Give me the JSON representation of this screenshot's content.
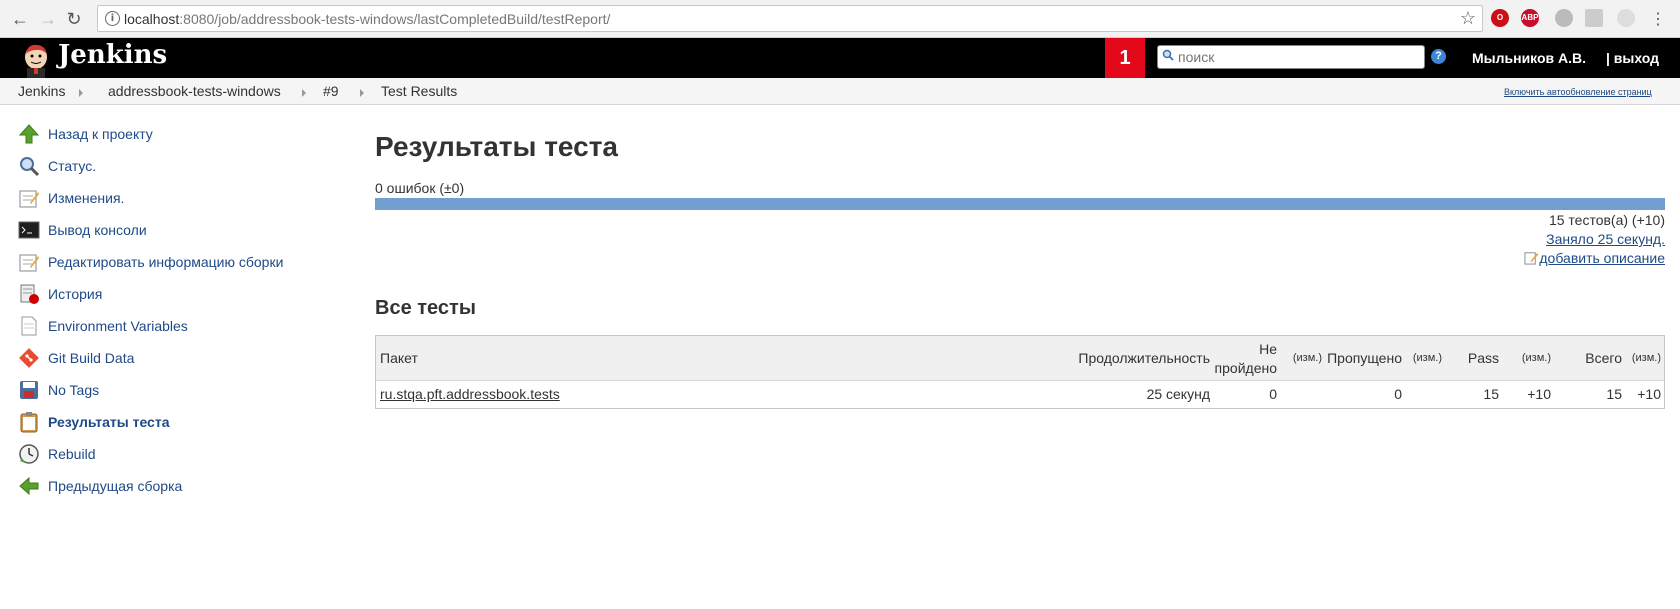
{
  "browser": {
    "url_host": "localhost",
    "url_rest": ":8080/job/addressbook-tests-windows/lastCompletedBuild/testReport/",
    "ext_abp": "ABP"
  },
  "header": {
    "brand": "Jenkins",
    "notification_count": "1",
    "search_placeholder": "поиск",
    "help": "?",
    "user": "Мыльников А.В.",
    "logout": "| выход"
  },
  "breadcrumb": {
    "items": [
      "Jenkins",
      "addressbook-tests-windows",
      "#9",
      "Test Results"
    ],
    "autorefresh": "Включить автообновление страниц"
  },
  "sidebar": {
    "items": [
      {
        "label": "Назад к проекту",
        "icon": "up-arrow-icon"
      },
      {
        "label": "Статус.",
        "icon": "magnifier-icon"
      },
      {
        "label": "Изменения.",
        "icon": "notepad-icon"
      },
      {
        "label": "Вывод консоли",
        "icon": "terminal-icon"
      },
      {
        "label": "Редактировать информацию сборки",
        "icon": "notepad-edit-icon"
      },
      {
        "label": "История",
        "icon": "history-icon"
      },
      {
        "label": "Environment Variables",
        "icon": "document-icon"
      },
      {
        "label": "Git Build Data",
        "icon": "git-icon"
      },
      {
        "label": "No Tags",
        "icon": "save-icon"
      },
      {
        "label": "Результаты теста",
        "icon": "clipboard-icon"
      },
      {
        "label": "Rebuild",
        "icon": "clock-icon"
      },
      {
        "label": "Предыдущая сборка",
        "icon": "back-arrow-icon"
      }
    ],
    "active_index": 9
  },
  "main": {
    "title": "Результаты теста",
    "failures": "0 ошибок (±0)",
    "progress_fraction": 1.0,
    "tests_count": "15 тестов(а) (+10)",
    "duration": "Заняло 25 секунд.",
    "add_description": "добавить описание",
    "section_title": "Все тесты"
  },
  "table": {
    "headers": {
      "package": "Пакет",
      "duration": "Продолжительность",
      "failed_line1": "Не",
      "failed_line2": "пройдено",
      "diff1": "(изм.)",
      "skipped": "Пропущено",
      "diff2": "(изм.)",
      "pass": "Pass",
      "diff3": "(изм.)",
      "total": "Всего",
      "diff4": "(изм.)"
    },
    "rows": [
      {
        "package": "ru.stqa.pft.addressbook.tests",
        "duration": "25 секунд",
        "failed": "0",
        "skipped": "0",
        "pass": "15",
        "pass_diff": "+10",
        "total": "15",
        "total_diff": "+10"
      }
    ]
  }
}
